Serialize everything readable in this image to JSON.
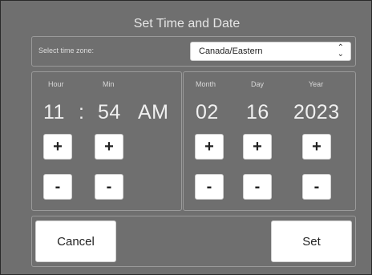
{
  "dialog": {
    "title": "Set Time and Date"
  },
  "timezone": {
    "label": "Select time zone:",
    "selected": "Canada/Eastern",
    "icon": "chevron-up-down-icon"
  },
  "time": {
    "hour_label": "Hour",
    "min_label": "Min",
    "hour": "11",
    "separator": ":",
    "minute": "54",
    "ampm": "AM"
  },
  "date": {
    "month_label": "Month",
    "day_label": "Day",
    "year_label": "Year",
    "month": "02",
    "day": "16",
    "year": "2023"
  },
  "controls": {
    "plus": "+",
    "minus": "-"
  },
  "actions": {
    "cancel": "Cancel",
    "set": "Set"
  },
  "colors": {
    "background": "#6f6f6f",
    "button": "#ffffff",
    "text": "#f0f0f0"
  }
}
